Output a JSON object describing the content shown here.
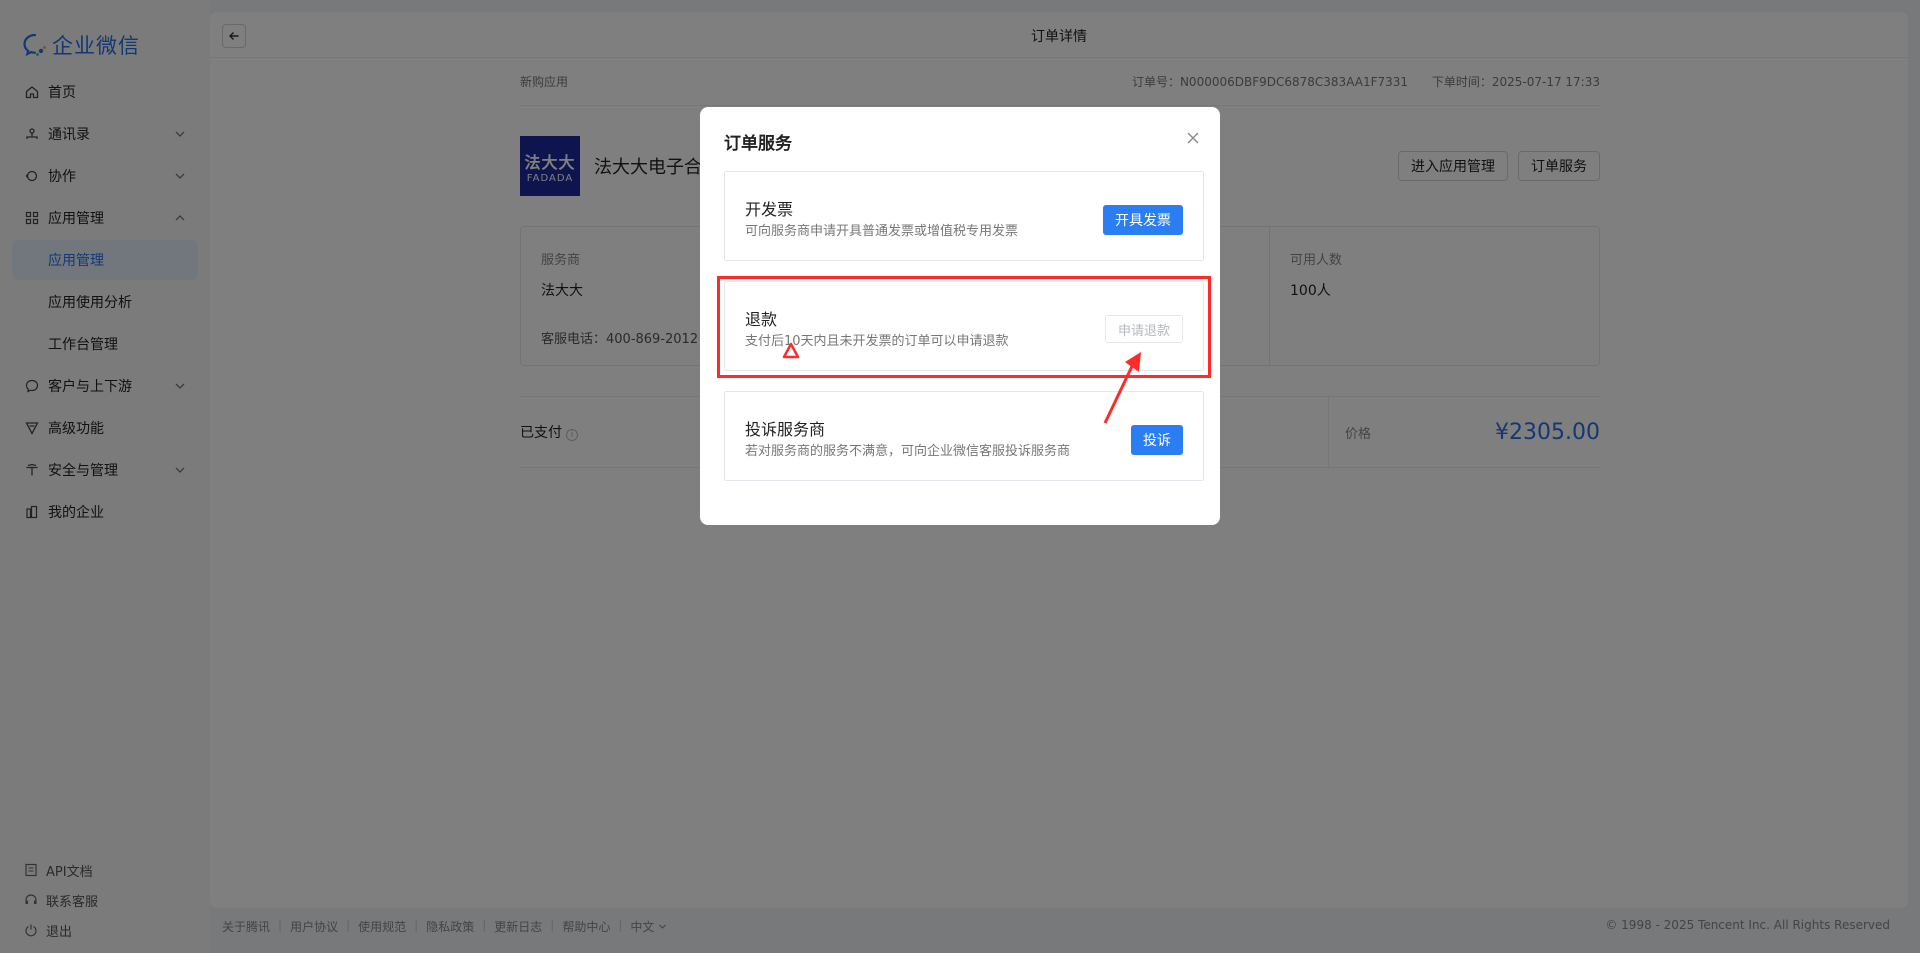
{
  "sidebar": {
    "logo_text": "企业微信",
    "items": [
      {
        "label": "首页",
        "icon": "home-icon"
      },
      {
        "label": "通讯录",
        "icon": "contacts-icon"
      },
      {
        "label": "协作",
        "icon": "collaboration-icon"
      },
      {
        "label": "应用管理",
        "icon": "apps-icon"
      },
      {
        "label": "应用管理"
      },
      {
        "label": "应用使用分析"
      },
      {
        "label": "工作台管理"
      },
      {
        "label": "客户与上下游",
        "icon": "chat-icon"
      },
      {
        "label": "高级功能",
        "icon": "advanced-icon"
      },
      {
        "label": "安全与管理",
        "icon": "security-icon"
      },
      {
        "label": "我的企业",
        "icon": "enterprise-icon"
      }
    ],
    "bottom": [
      {
        "label": "API文档",
        "icon": "doc-icon"
      },
      {
        "label": "联系客服",
        "icon": "headset-icon"
      },
      {
        "label": "退出",
        "icon": "power-icon"
      }
    ]
  },
  "page": {
    "title": "订单详情",
    "section_label": "新购应用",
    "order_no": "订单号：N000006DBF9DC6878C383AA1F7331",
    "order_time": "下单时间：2025-07-17 17:33"
  },
  "app": {
    "logo_line1": "法大大",
    "logo_line2": "FADADA",
    "name": "法大大电子合",
    "enter_manage": "进入应用管理",
    "order_service": "订单服务"
  },
  "info": {
    "provider_label": "服务商",
    "provider_value": "法大大",
    "phone": "客服电话：400-869-2012",
    "users_label": "可用人数",
    "users_value": "100人"
  },
  "payment": {
    "status": "已支付",
    "price_label": "价格",
    "price": "¥2305.00"
  },
  "footer": {
    "links": [
      "关于腾讯",
      "用户协议",
      "使用规范",
      "隐私政策",
      "更新日志",
      "帮助中心",
      "中文"
    ],
    "copyright": "© 1998 - 2025 Tencent Inc. All Rights Reserved"
  },
  "modal": {
    "title": "订单服务",
    "cards": [
      {
        "title": "开发票",
        "desc": "可向服务商申请开具普通发票或增值税专用发票",
        "button": "开具发票"
      },
      {
        "title": "退款",
        "desc": "支付后10天内且未开发票的订单可以申请退款",
        "button": "申请退款"
      },
      {
        "title": "投诉服务商",
        "desc": "若对服务商的服务不满意，可向企业微信客服投诉服务商",
        "button": "投诉"
      }
    ]
  },
  "colors": {
    "accent": "#2a7ef2",
    "annotation": "#ff2a2a"
  }
}
